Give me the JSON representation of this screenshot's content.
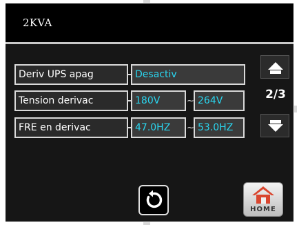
{
  "header": {
    "title": "2KVA"
  },
  "rows": [
    {
      "label": "Deriv UPS apag",
      "value": "Desactiv"
    },
    {
      "label": "Tension derivac",
      "min": "180V",
      "separator": "~",
      "max": "264V"
    },
    {
      "label": "FRE en derivac",
      "min": "47.0HZ",
      "separator": "~",
      "max": "53.0HZ"
    }
  ],
  "nav": {
    "page": "2/3",
    "up_icon": "arrow-up-icon",
    "down_icon": "arrow-down-icon"
  },
  "footer": {
    "refresh_icon": "refresh-icon",
    "home_label": "HOME",
    "home_icon": "home-icon"
  },
  "colors": {
    "value_text": "#2ad6f0",
    "background": "#161616",
    "home_roof": "#d9462f"
  }
}
